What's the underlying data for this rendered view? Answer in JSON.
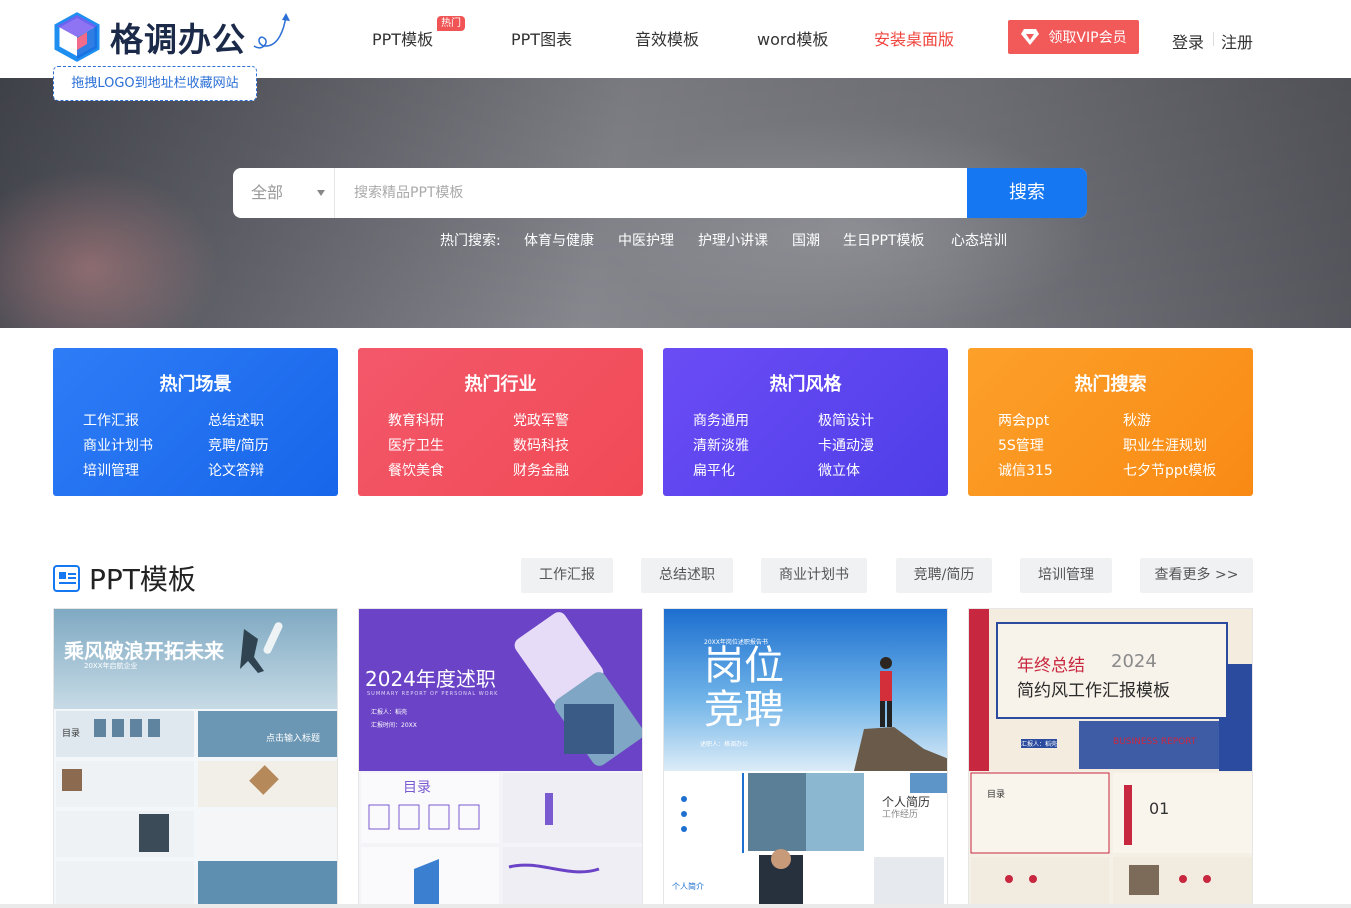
{
  "header": {
    "logo_text": "格调办公",
    "drag_tip": "拖拽LOGO到地址栏收藏网站",
    "nav": [
      {
        "label": "PPT模板",
        "badge": "热门"
      },
      {
        "label": "PPT图表"
      },
      {
        "label": "音效模板"
      },
      {
        "label": "word模板"
      },
      {
        "label": "安装桌面版",
        "color": "#f0453e"
      }
    ],
    "vip_label": "领取VIP会员",
    "login_label": "登录",
    "register_label": "注册"
  },
  "search": {
    "category": "全部",
    "placeholder": "搜索精品PPT模板",
    "button_label": "搜索",
    "hot_prefix": "热门搜索:",
    "hot_terms": [
      "体育与健康",
      "中医护理",
      "护理小讲课",
      "国潮",
      "生日PPT模板",
      "心态培训"
    ]
  },
  "categories": [
    {
      "title": "热门场景",
      "items": [
        "工作汇报",
        "总结述职",
        "商业计划书",
        "竞聘/简历",
        "培训管理",
        "论文答辩"
      ]
    },
    {
      "title": "热门行业",
      "items": [
        "教育科研",
        "党政军警",
        "医疗卫生",
        "数码科技",
        "餐饮美食",
        "财务金融"
      ]
    },
    {
      "title": "热门风格",
      "items": [
        "商务通用",
        "极简设计",
        "清新淡雅",
        "卡通动漫",
        "扁平化",
        "微立体"
      ]
    },
    {
      "title": "热门搜索",
      "items": [
        "两会ppt",
        "秋游",
        "5S管理",
        "职业生涯规划",
        "诚信315",
        "七夕节ppt模板"
      ]
    }
  ],
  "ppt_section": {
    "title": "PPT模板",
    "tabs": [
      "工作汇报",
      "总结述职",
      "商业计划书",
      "竞聘/简历",
      "培训管理",
      "查看更多 >>"
    ]
  },
  "templates": [
    {
      "title": "乘风破浪开拓未来",
      "sub": "20XX年启航企业",
      "toc": "目录",
      "slide_title": "点击输入标题"
    },
    {
      "title": "2024年度述职",
      "sub": "SUMMARY REPORT OF PERSONAL WORK",
      "reporter": "汇报人：稻壳",
      "date": "汇报时间：20XX",
      "toc": "目录"
    },
    {
      "title_a": "岗位",
      "title_b": "竞聘",
      "header": "20XX年岗位述职报告书",
      "reporter": "述职人：格调办公",
      "resume": "个人简历",
      "resume_en": "工作经历",
      "intro": "个人简介"
    },
    {
      "title_a": "年终总结",
      "year": "2024",
      "title_b": "简约风工作汇报模板",
      "reporter": "汇报人：稻壳",
      "brand": "BUSINESS REPORT",
      "toc": "目录",
      "num": "01"
    }
  ]
}
